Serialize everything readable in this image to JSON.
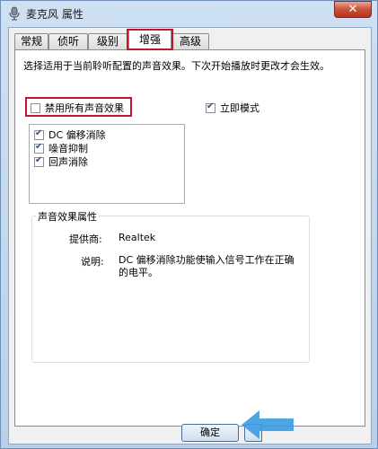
{
  "window": {
    "title": "麦克风 属性",
    "close_glyph": "✕"
  },
  "tabs": [
    {
      "label": "常规"
    },
    {
      "label": "侦听"
    },
    {
      "label": "级别"
    },
    {
      "label": "增强",
      "active": true
    },
    {
      "label": "高级"
    }
  ],
  "enhance": {
    "description": "选择适用于当前聆听配置的声音效果。下次开始播放时更改才会生效。",
    "disable_all_label": "禁用所有声音效果",
    "disable_all_checked": false,
    "immediate_mode_label": "立即模式",
    "immediate_mode_checked": true,
    "effects": [
      {
        "label": "DC 偏移消除",
        "checked": true
      },
      {
        "label": "噪音抑制",
        "checked": true
      },
      {
        "label": "回声消除",
        "checked": true
      }
    ],
    "properties_title": "声音效果属性",
    "provider_label": "提供商:",
    "provider_value": "Realtek",
    "explanation_label": "说明:",
    "explanation_value": "DC 偏移消除功能使输入信号工作在正确的电平。"
  },
  "buttons": {
    "ok_label": "确定"
  },
  "colors": {
    "highlight": "#c0182a",
    "arrow": "#3a9be0"
  }
}
